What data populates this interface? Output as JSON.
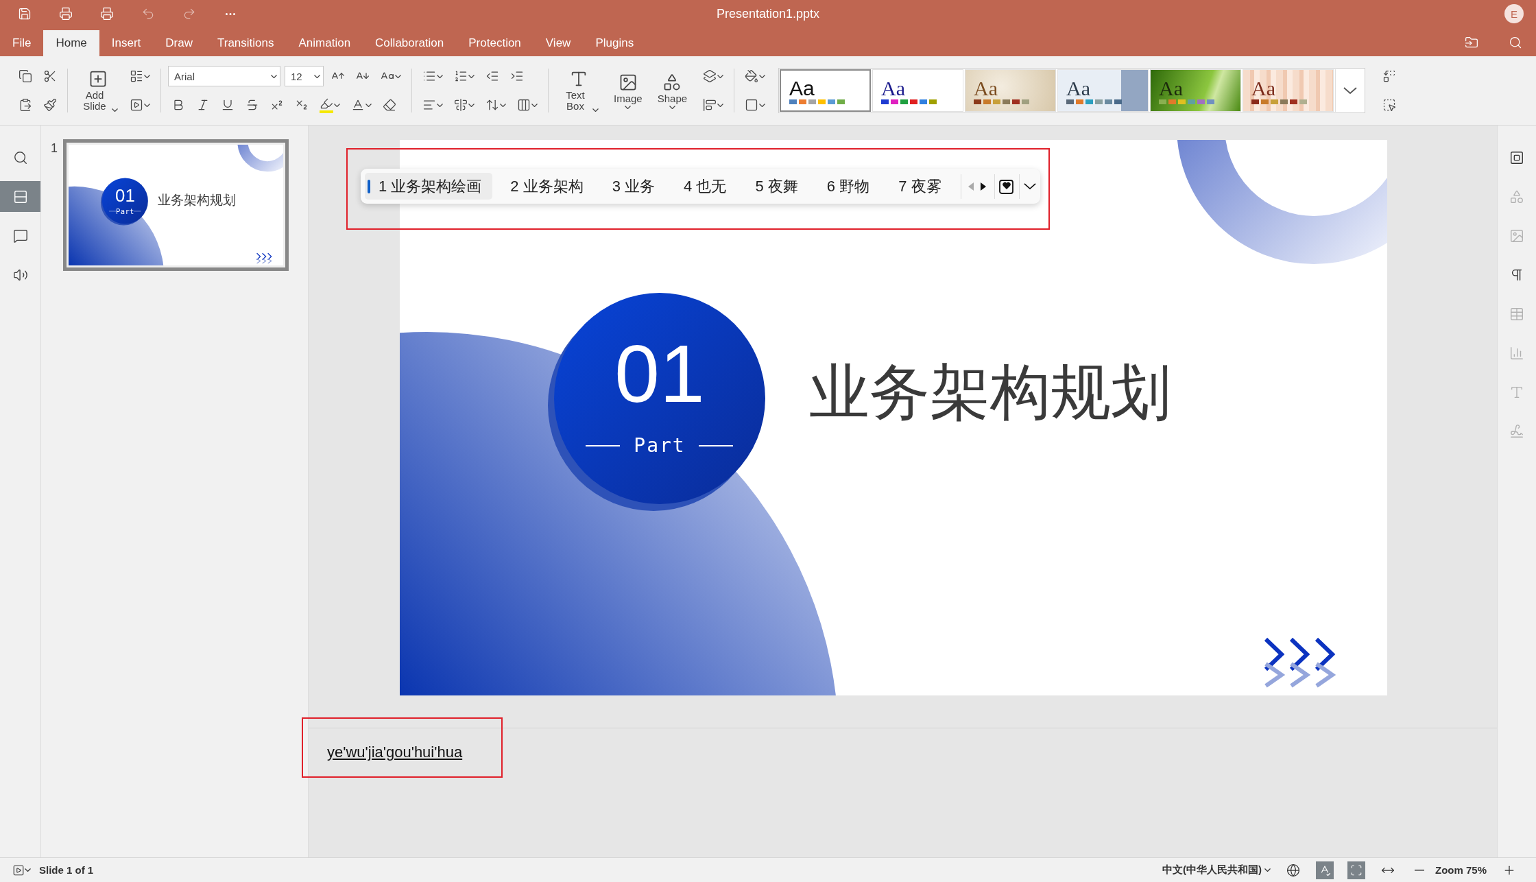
{
  "window": {
    "title": "Presentation1.pptx",
    "avatar": "E"
  },
  "menu_tabs": [
    {
      "label": "File",
      "selected": false
    },
    {
      "label": "Home",
      "selected": true
    },
    {
      "label": "Insert",
      "selected": false
    },
    {
      "label": "Draw",
      "selected": false
    },
    {
      "label": "Transitions",
      "selected": false
    },
    {
      "label": "Animation",
      "selected": false
    },
    {
      "label": "Collaboration",
      "selected": false
    },
    {
      "label": "Protection",
      "selected": false
    },
    {
      "label": "View",
      "selected": false
    },
    {
      "label": "Plugins",
      "selected": false
    }
  ],
  "ribbon": {
    "font_name": "Arial",
    "font_size": "12",
    "add_slide": "Add Slide",
    "text_box": "Text Box",
    "image": "Image",
    "shape": "Shape",
    "themes": [
      {
        "kind": "plain",
        "label": "Aa",
        "selected": true
      },
      {
        "kind": "colorful",
        "label": "Aa",
        "selected": false
      },
      {
        "kind": "parchment",
        "label": "Aa",
        "selected": false
      },
      {
        "kind": "sky",
        "label": "Aa",
        "selected": false
      },
      {
        "kind": "green",
        "label": "Aa",
        "selected": false
      },
      {
        "kind": "stripes",
        "label": "Aa",
        "selected": false
      }
    ]
  },
  "left_rail": [
    {
      "kind": "search",
      "selected": false
    },
    {
      "kind": "slides",
      "selected": true
    },
    {
      "kind": "comments",
      "selected": false
    },
    {
      "kind": "audio",
      "selected": false
    }
  ],
  "thumbnails": [
    {
      "number": "1",
      "selected": true,
      "badge": "01",
      "part": "Part",
      "title": "业务架构规划"
    }
  ],
  "slide": {
    "badge": "01",
    "part": "Part",
    "title": "业务架构规划"
  },
  "ime": {
    "candidates": [
      {
        "text": "1 业务架构绘画",
        "selected": true
      },
      {
        "text": "2 业务架构",
        "selected": false
      },
      {
        "text": "3 业务",
        "selected": false
      },
      {
        "text": "4 也无",
        "selected": false
      },
      {
        "text": "5 夜舞",
        "selected": false
      },
      {
        "text": "6 野物",
        "selected": false
      },
      {
        "text": "7 夜雾",
        "selected": false
      }
    ],
    "prev_disabled": true
  },
  "notes": {
    "text": "ye'wu'jia'gou'hui'hua"
  },
  "right_rail": [
    {
      "kind": "slide-settings",
      "disabled": false
    },
    {
      "kind": "shape",
      "disabled": true
    },
    {
      "kind": "image",
      "disabled": true
    },
    {
      "kind": "paragraph",
      "disabled": false
    },
    {
      "kind": "table",
      "disabled": true
    },
    {
      "kind": "chart",
      "disabled": true
    },
    {
      "kind": "text-art",
      "disabled": true
    },
    {
      "kind": "signature",
      "disabled": true
    }
  ],
  "status_bar": {
    "slide_info": "Slide 1 of 1",
    "language": "中文(中华人民共和国)",
    "zoom": "Zoom 75%"
  }
}
